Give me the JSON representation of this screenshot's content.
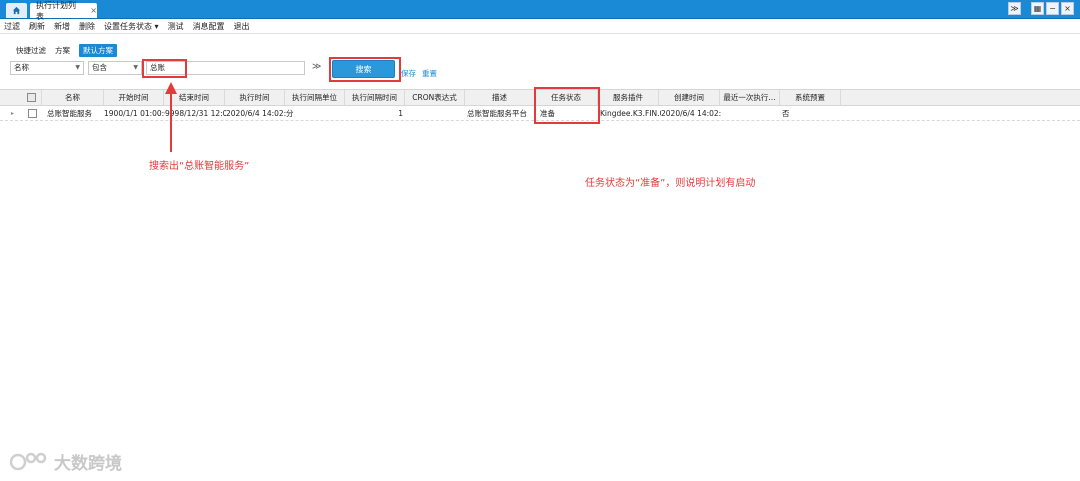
{
  "tabs": {
    "home_icon": "home-icon",
    "active_label": "执行计划列表",
    "close": "×"
  },
  "window_controls": {
    "dropdown": "≫",
    "grid": "▦",
    "minimize": "−",
    "close": "×"
  },
  "toolbar": {
    "items": [
      "过滤",
      "刷新",
      "新增",
      "删除",
      "设置任务状态 ▾",
      "测试",
      "消息配置",
      "退出"
    ]
  },
  "filter": {
    "quick_label": "快捷过滤",
    "scheme_label": "方案",
    "default_scheme": "默认方案",
    "field": "名称",
    "operator": "包含",
    "value": "总账",
    "search_button": "搜索",
    "save_link": "保存",
    "reset_link": "重置",
    "expand_icon": "≫"
  },
  "grid": {
    "columns": [
      "名称",
      "开始时间",
      "结束时间",
      "执行时间",
      "执行间隔单位",
      "执行间隔时间",
      "CRON表达式",
      "描述",
      "任务状态",
      "服务插件",
      "创建时间",
      "最近一次执行...",
      "系统预置"
    ],
    "rows": [
      {
        "name": "总账智能服务",
        "start": "1900/1/1 01:00:00",
        "end": "9998/12/31 12:00:",
        "exec": "2020/6/4 14:02:05",
        "unit": "分",
        "interval": "1",
        "cron": "",
        "desc": "总账智能服务平台",
        "status": "准备",
        "plugin": "Kingdee.K3.FIN.G",
        "created": "2020/6/4 14:02:05",
        "last_run": "",
        "preset": "否"
      }
    ]
  },
  "annotations": {
    "search_note": "搜索出“总账智能服务”",
    "status_note": "任务状态为“准备”，则说明计划有启动"
  },
  "watermark": {
    "text": "大数跨境"
  },
  "colors": {
    "accent": "#1a8ad6",
    "annotation": "#e33b3b"
  }
}
